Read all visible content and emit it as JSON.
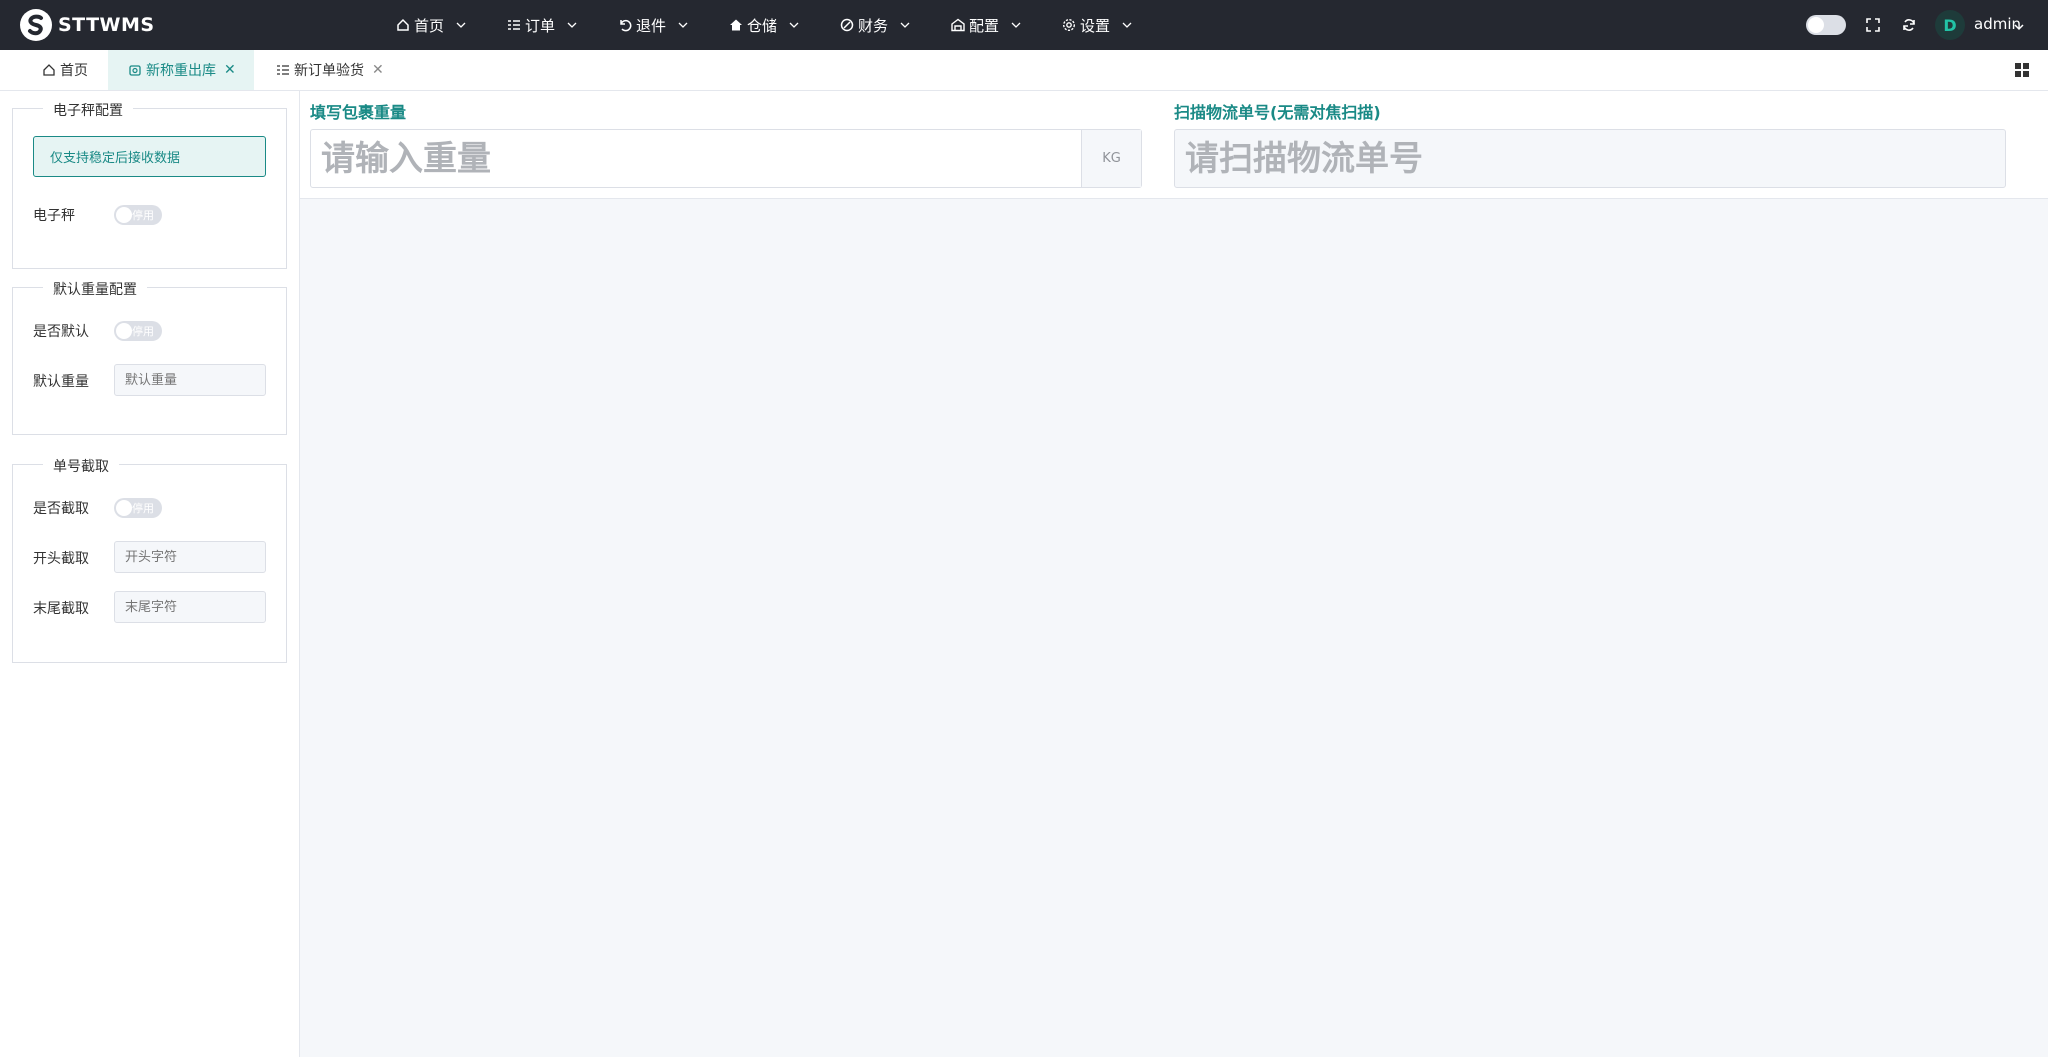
{
  "header": {
    "brand": "STTWMS",
    "menu": [
      {
        "label": "首页",
        "icon": "home-icon"
      },
      {
        "label": "订单",
        "icon": "list-icon"
      },
      {
        "label": "退件",
        "icon": "undo-icon"
      },
      {
        "label": "仓储",
        "icon": "house-icon"
      },
      {
        "label": "财务",
        "icon": "coin-icon"
      },
      {
        "label": "配置",
        "icon": "warehouse-icon"
      },
      {
        "label": "设置",
        "icon": "gear-icon"
      }
    ],
    "user": "admin",
    "avatar_letter": "D"
  },
  "tabs": [
    {
      "label": "首页",
      "icon": "home-icon",
      "active": false,
      "closable": false
    },
    {
      "label": "新称重出库",
      "icon": "scale-icon",
      "active": true,
      "closable": true
    },
    {
      "label": "新订单验货",
      "icon": "list-icon",
      "active": false,
      "closable": true
    }
  ],
  "left_panel": {
    "scale_config": {
      "legend": "电子秤配置",
      "notice": "仅支持稳定后接收数据",
      "scale_label": "电子秤",
      "scale_switch": "停用"
    },
    "default_weight": {
      "legend": "默认重量配置",
      "is_default_label": "是否默认",
      "is_default_switch": "停用",
      "weight_label": "默认重量",
      "weight_placeholder": "默认重量"
    },
    "truncate": {
      "legend": "单号截取",
      "is_truncate_label": "是否截取",
      "is_truncate_switch": "停用",
      "start_label": "开头截取",
      "start_placeholder": "开头字符",
      "end_label": "末尾截取",
      "end_placeholder": "末尾字符"
    }
  },
  "main": {
    "weight_title": "填写包裹重量",
    "weight_placeholder": "请输入重量",
    "weight_unit": "KG",
    "tracking_title": "扫描物流单号(无需对焦扫描)",
    "tracking_placeholder": "请扫描物流单号"
  },
  "colors": {
    "topbar": "#252830",
    "accent": "#1a8a86",
    "main_bg": "#f5f7fa"
  }
}
